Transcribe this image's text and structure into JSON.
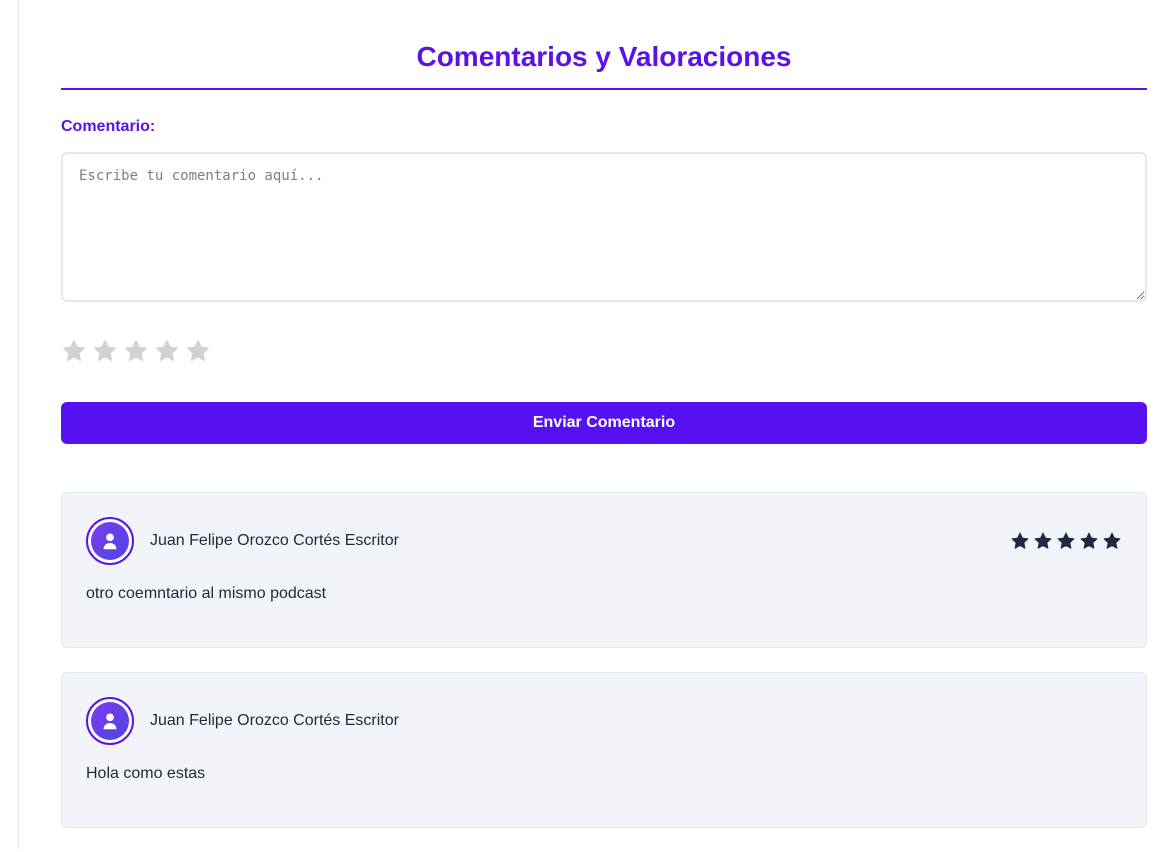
{
  "page": {
    "title": "Comentarios y Valoraciones"
  },
  "form": {
    "label": "Comentario:",
    "placeholder": "Escribe tu comentario aquí...",
    "value": "",
    "rating": 0,
    "max_rating": 5,
    "submit_label": "Enviar Comentario"
  },
  "comments": [
    {
      "author": "Juan Felipe Orozco Cortés Escritor",
      "text": "otro coemntario al mismo podcast",
      "rating": 5
    },
    {
      "author": "Juan Felipe Orozco Cortés Escritor",
      "text": "Hola como estas",
      "rating": 0
    }
  ],
  "colors": {
    "accent": "#5a12e8",
    "button": "#5511f0",
    "star_empty": "#cfd2d8",
    "star_filled": "#1e2a44",
    "card_bg": "#f1f4f9"
  }
}
